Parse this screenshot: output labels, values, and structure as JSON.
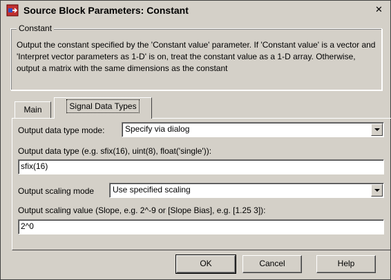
{
  "window": {
    "title": "Source Block Parameters: Constant",
    "close_label": "✕"
  },
  "group": {
    "legend": "Constant",
    "description": "Output the constant specified by the 'Constant value' parameter. If 'Constant value' is a vector and 'Interpret vector parameters as 1-D' is on, treat the constant value as a 1-D array. Otherwise, output a matrix with the same dimensions as the constant"
  },
  "tabs": [
    {
      "label": "Main",
      "selected": false
    },
    {
      "label": "Signal Data Types",
      "selected": true
    }
  ],
  "panel": {
    "data_type_mode_label": "Output data type mode:",
    "data_type_mode_value": "Specify via dialog",
    "data_type_label": "Output data type (e.g. sfix(16), uint(8), float('single')):",
    "data_type_value": "sfix(16)",
    "scaling_mode_label": "Output scaling mode",
    "scaling_mode_value": "Use specified scaling",
    "scaling_value_label": "Output scaling value (Slope, e.g. 2^-9 or [Slope Bias], e.g. [1.25 3]):",
    "scaling_value_value": "2^0"
  },
  "buttons": {
    "ok": "OK",
    "cancel": "Cancel",
    "help": "Help"
  },
  "icons": [
    "simulink-block-icon",
    "close-icon",
    "dropdown-arrow-icon"
  ]
}
